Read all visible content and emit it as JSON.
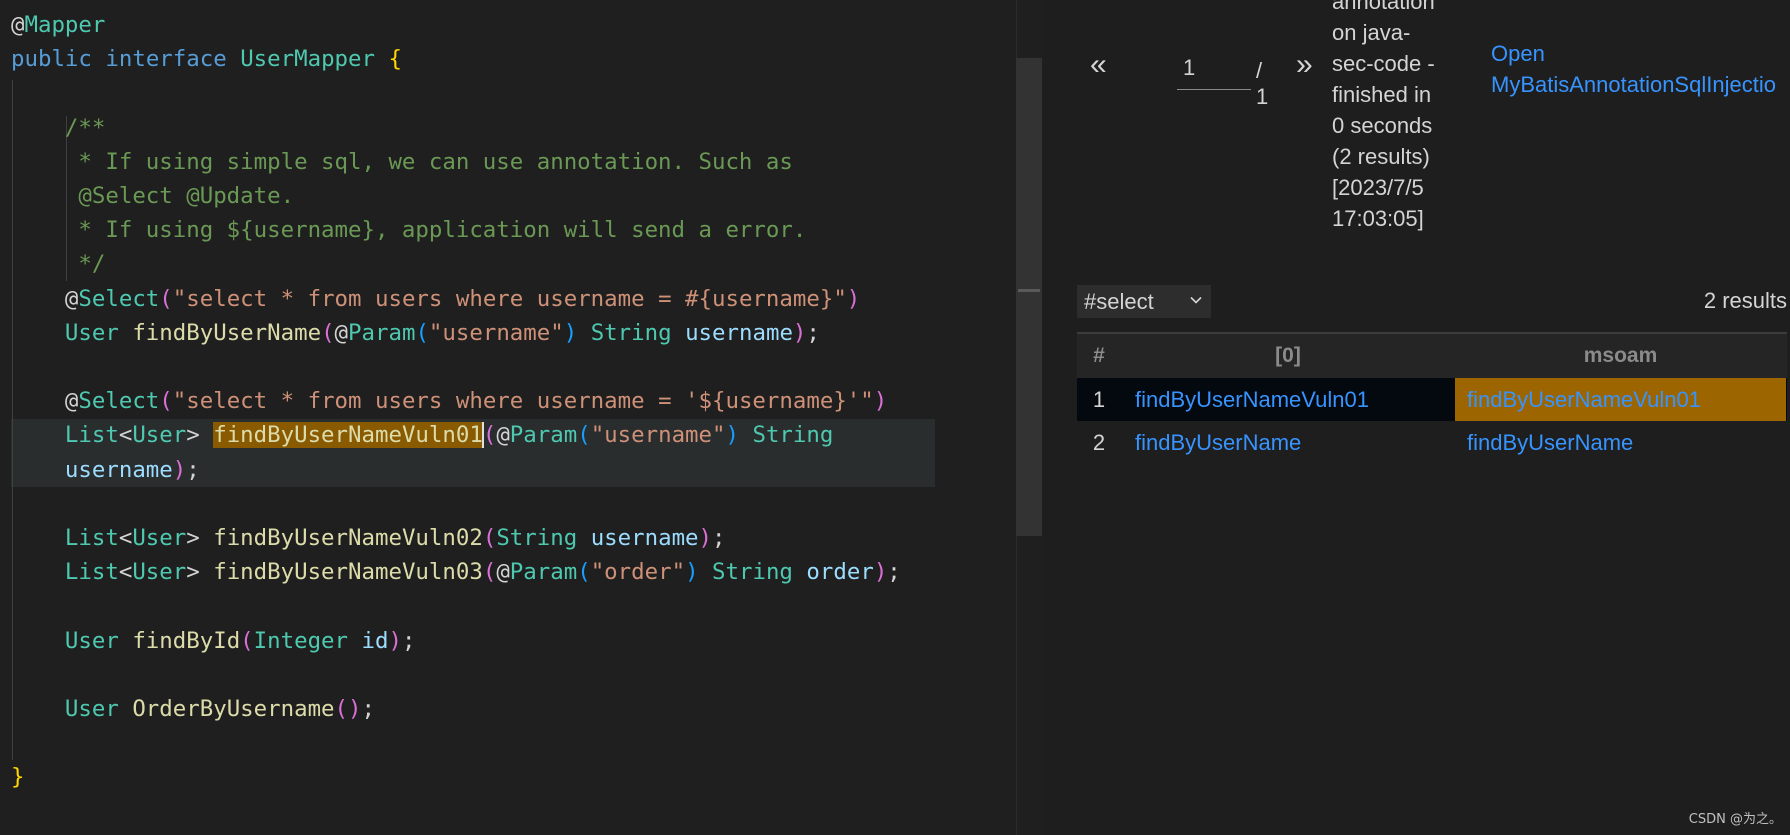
{
  "editor": {
    "lines": [
      [
        {
          "t": "@",
          "c": "plain"
        },
        {
          "t": "Mapper",
          "c": "ty"
        }
      ],
      [
        {
          "t": "public",
          "c": "kw"
        },
        {
          "t": " ",
          "c": "plain"
        },
        {
          "t": "interface",
          "c": "kw"
        },
        {
          "t": " ",
          "c": "plain"
        },
        {
          "t": "UserMapper",
          "c": "ty"
        },
        {
          "t": " ",
          "c": "plain"
        },
        {
          "t": "{",
          "c": "br1"
        }
      ],
      [],
      [
        {
          "t": "    /**",
          "c": "cm"
        }
      ],
      [
        {
          "t": "     * If using simple sql, we can use annotation. Such as",
          "c": "cm"
        }
      ],
      [
        {
          "t": "     @Select @Update.",
          "c": "cm"
        }
      ],
      [
        {
          "t": "     * If using ${username}, application will send a error.",
          "c": "cm"
        }
      ],
      [
        {
          "t": "     */",
          "c": "cm"
        }
      ],
      [
        {
          "t": "    @",
          "c": "plain"
        },
        {
          "t": "Select",
          "c": "ty"
        },
        {
          "t": "(",
          "c": "br2"
        },
        {
          "t": "\"select * from users where username = #{username}\"",
          "c": "str"
        },
        {
          "t": ")",
          "c": "br2"
        }
      ],
      [
        {
          "t": "    ",
          "c": "plain"
        },
        {
          "t": "User",
          "c": "ty"
        },
        {
          "t": " ",
          "c": "plain"
        },
        {
          "t": "findByUserName",
          "c": "fn"
        },
        {
          "t": "(",
          "c": "br2"
        },
        {
          "t": "@",
          "c": "plain"
        },
        {
          "t": "Param",
          "c": "ty"
        },
        {
          "t": "(",
          "c": "br3"
        },
        {
          "t": "\"username\"",
          "c": "str"
        },
        {
          "t": ")",
          "c": "br3"
        },
        {
          "t": " ",
          "c": "plain"
        },
        {
          "t": "String",
          "c": "ty"
        },
        {
          "t": " ",
          "c": "plain"
        },
        {
          "t": "username",
          "c": "vr"
        },
        {
          "t": ")",
          "c": "br2"
        },
        {
          "t": ";",
          "c": "plain"
        }
      ],
      [],
      [
        {
          "t": "    @",
          "c": "plain"
        },
        {
          "t": "Select",
          "c": "ty"
        },
        {
          "t": "(",
          "c": "br2"
        },
        {
          "t": "\"select * from users where username = '${username}'\"",
          "c": "str"
        },
        {
          "t": ")",
          "c": "br2"
        }
      ],
      [
        {
          "t": "    ",
          "c": "plain"
        },
        {
          "t": "List",
          "c": "ty"
        },
        {
          "t": "<",
          "c": "plain"
        },
        {
          "t": "User",
          "c": "ty"
        },
        {
          "t": "> ",
          "c": "plain"
        },
        {
          "t": "findByUserNameVuln01",
          "c": "fn hl"
        },
        {
          "t": "CURSOR",
          "c": "cursor"
        },
        {
          "t": "(",
          "c": "br2"
        },
        {
          "t": "@",
          "c": "plain"
        },
        {
          "t": "Param",
          "c": "ty"
        },
        {
          "t": "(",
          "c": "br3"
        },
        {
          "t": "\"username\"",
          "c": "str"
        },
        {
          "t": ")",
          "c": "br3"
        },
        {
          "t": " ",
          "c": "plain"
        },
        {
          "t": "String",
          "c": "ty"
        }
      ],
      [
        {
          "t": "    ",
          "c": "plain"
        },
        {
          "t": "username",
          "c": "vr"
        },
        {
          "t": ")",
          "c": "br2"
        },
        {
          "t": ";",
          "c": "plain"
        }
      ],
      [],
      [
        {
          "t": "    ",
          "c": "plain"
        },
        {
          "t": "List",
          "c": "ty"
        },
        {
          "t": "<",
          "c": "plain"
        },
        {
          "t": "User",
          "c": "ty"
        },
        {
          "t": "> ",
          "c": "plain"
        },
        {
          "t": "findByUserNameVuln02",
          "c": "fn"
        },
        {
          "t": "(",
          "c": "br2"
        },
        {
          "t": "String",
          "c": "ty"
        },
        {
          "t": " ",
          "c": "plain"
        },
        {
          "t": "username",
          "c": "vr"
        },
        {
          "t": ")",
          "c": "br2"
        },
        {
          "t": ";",
          "c": "plain"
        }
      ],
      [
        {
          "t": "    ",
          "c": "plain"
        },
        {
          "t": "List",
          "c": "ty"
        },
        {
          "t": "<",
          "c": "plain"
        },
        {
          "t": "User",
          "c": "ty"
        },
        {
          "t": "> ",
          "c": "plain"
        },
        {
          "t": "findByUserNameVuln03",
          "c": "fn"
        },
        {
          "t": "(",
          "c": "br2"
        },
        {
          "t": "@",
          "c": "plain"
        },
        {
          "t": "Param",
          "c": "ty"
        },
        {
          "t": "(",
          "c": "br3"
        },
        {
          "t": "\"order\"",
          "c": "str"
        },
        {
          "t": ")",
          "c": "br3"
        },
        {
          "t": " ",
          "c": "plain"
        },
        {
          "t": "String",
          "c": "ty"
        },
        {
          "t": " ",
          "c": "plain"
        },
        {
          "t": "order",
          "c": "vr"
        },
        {
          "t": ")",
          "c": "br2"
        },
        {
          "t": ";",
          "c": "plain"
        }
      ],
      [],
      [
        {
          "t": "    ",
          "c": "plain"
        },
        {
          "t": "User",
          "c": "ty"
        },
        {
          "t": " ",
          "c": "plain"
        },
        {
          "t": "findById",
          "c": "fn"
        },
        {
          "t": "(",
          "c": "br2"
        },
        {
          "t": "Integer",
          "c": "ty"
        },
        {
          "t": " ",
          "c": "plain"
        },
        {
          "t": "id",
          "c": "vr"
        },
        {
          "t": ")",
          "c": "br2"
        },
        {
          "t": ";",
          "c": "plain"
        }
      ],
      [],
      [
        {
          "t": "    ",
          "c": "plain"
        },
        {
          "t": "User",
          "c": "ty"
        },
        {
          "t": " ",
          "c": "plain"
        },
        {
          "t": "OrderByUsername",
          "c": "fn"
        },
        {
          "t": "()",
          "c": "br2"
        },
        {
          "t": ";",
          "c": "plain"
        }
      ],
      [],
      [
        {
          "t": "}",
          "c": "br1"
        }
      ]
    ]
  },
  "results": {
    "pager": {
      "prev": "«",
      "page": "1",
      "total": "/ 1",
      "next": "»"
    },
    "status_lines": [
      "annotation",
      "on java-",
      "sec-code -",
      "finished in",
      "0 seconds",
      "(2 results)",
      "[2023/7/5",
      "17:03:05]"
    ],
    "open_link_lines": [
      "Open",
      "MyBatisAnnotationSqlInjectio"
    ],
    "select_value": "#select",
    "result_count": "2 results",
    "columns": [
      "#",
      "[0]",
      "msoam"
    ],
    "rows": [
      {
        "idx": "1",
        "c0": "findByUserNameVuln01",
        "c1": "findByUserNameVuln01",
        "selected": true
      },
      {
        "idx": "2",
        "c0": "findByUserName",
        "c1": "findByUserName",
        "selected": false
      }
    ]
  },
  "watermark": "CSDN @为之。"
}
